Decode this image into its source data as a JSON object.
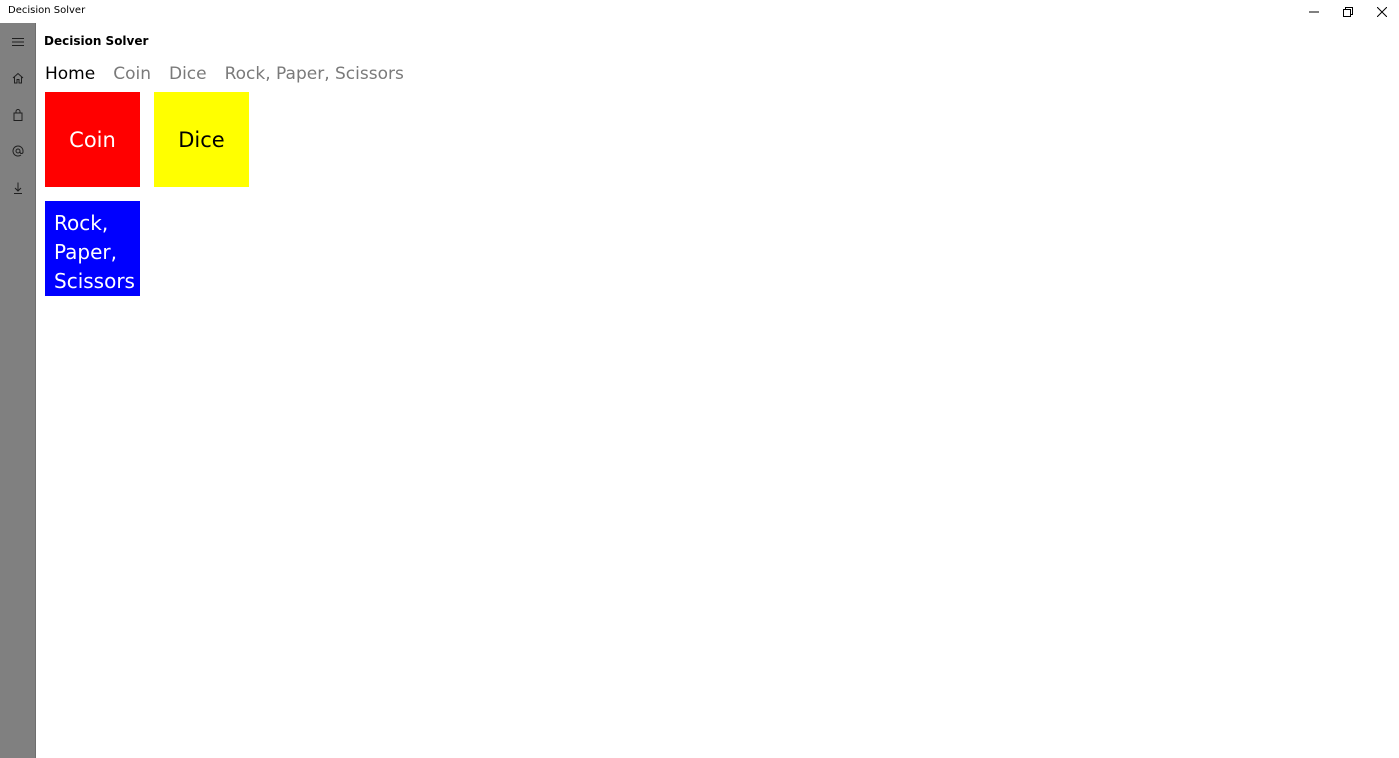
{
  "window": {
    "title": "Decision Solver",
    "controls": [
      "minimize-icon",
      "restore-icon",
      "close-icon"
    ]
  },
  "sidebar": {
    "items": [
      {
        "icon": "hamburger-menu-icon"
      },
      {
        "icon": "home-icon"
      },
      {
        "icon": "shopping-bag-icon"
      },
      {
        "icon": "at-sign-icon"
      },
      {
        "icon": "download-icon"
      }
    ],
    "background": "#808080"
  },
  "header": {
    "app_title": "Decision Solver"
  },
  "pivot": {
    "tabs": [
      {
        "label": "Home",
        "active": true
      },
      {
        "label": "Coin",
        "active": false
      },
      {
        "label": "Dice",
        "active": false
      },
      {
        "label": "Rock, Paper, Scissors",
        "active": false
      }
    ]
  },
  "tiles": {
    "coin": {
      "label": "Coin",
      "color": "#ff0000"
    },
    "dice": {
      "label": "Dice",
      "color": "#ffff00"
    },
    "rps": {
      "lines": [
        "Rock,",
        "Paper,",
        "Scissors"
      ],
      "color": "#0000ff"
    }
  }
}
